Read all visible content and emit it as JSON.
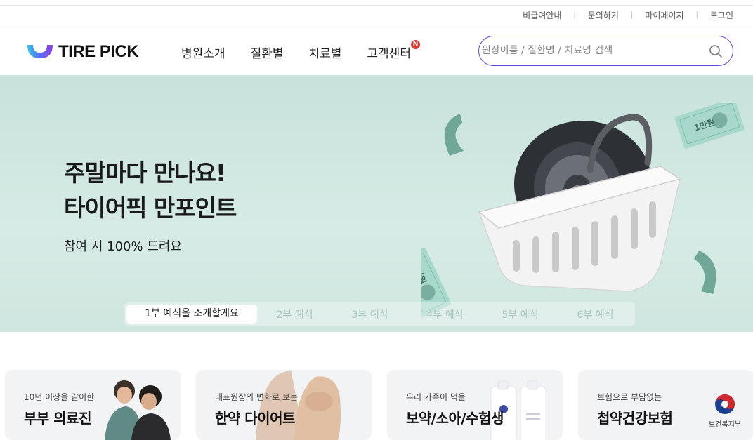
{
  "util_links": [
    "비급여안내",
    "문의하기",
    "마이페이지",
    "로그인"
  ],
  "util_separator": "|",
  "brand": {
    "name": "TIRE PICK",
    "accent": "#6a3fd6"
  },
  "nav": [
    {
      "label": "병원소개"
    },
    {
      "label": "질환별"
    },
    {
      "label": "치료별"
    },
    {
      "label": "고객센터",
      "badge": "N"
    }
  ],
  "search": {
    "placeholder": "원장이름 / 질환명 / 치료명 검색",
    "value": "",
    "icon": "search-icon"
  },
  "hero": {
    "title_line1": "주말마다 만나요!",
    "title_line2": "타이어픽 만포인트",
    "subtitle": "참여 시 100% 드려요",
    "bill_label": "1만원",
    "tabs": [
      "1부 예식을 소개할게요",
      "2부 예식",
      "3부 예식",
      "4부 예식",
      "5부 예식",
      "6부 예식"
    ],
    "active_tab": 0
  },
  "cards": [
    {
      "small": "10년 이상을 같이한",
      "big": "부부 의료진"
    },
    {
      "small": "대표원장의 변화로 보는",
      "big": "한약 다이어트"
    },
    {
      "small": "우리 가족이 먹을",
      "big": "보약/소아/수험생"
    },
    {
      "small": "보험으로 부담없는",
      "big": "첩약건강보험",
      "logo_text": "보건복지부"
    }
  ]
}
